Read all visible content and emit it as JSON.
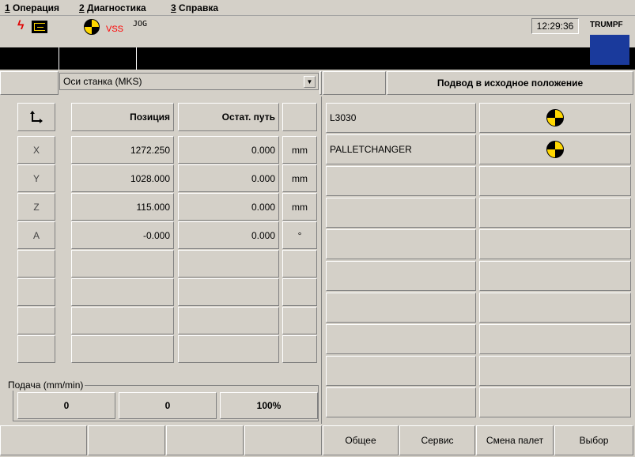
{
  "menu": [
    {
      "key": "1",
      "label": "Операция"
    },
    {
      "key": "2",
      "label": "Диагностика"
    },
    {
      "key": "3",
      "label": "Справка"
    }
  ],
  "status": {
    "vss_label": "VSS",
    "mode": "JOG",
    "time": "12:29:36",
    "brand": "TRUMPF",
    "colors": {
      "vss": "#ff0000",
      "brand_box": "#1a3a9c"
    }
  },
  "axes_panel": {
    "selector_value": "Оси станка (MKS)",
    "col_position": "Позиция",
    "col_remaining": "Остат. путь",
    "rows": [
      {
        "axis": "X",
        "position": "1272.250",
        "remaining": "0.000",
        "unit": "mm"
      },
      {
        "axis": "Y",
        "position": "1028.000",
        "remaining": "0.000",
        "unit": "mm"
      },
      {
        "axis": "Z",
        "position": "115.000",
        "remaining": "0.000",
        "unit": "mm"
      },
      {
        "axis": "A",
        "position": "-0.000",
        "remaining": "0.000",
        "unit": "°"
      }
    ],
    "feed_label": "Подача (mm/min)",
    "feed_values": [
      "0",
      "0",
      "100%"
    ]
  },
  "reference_panel": {
    "title": "Подвод в исходное положение",
    "items": [
      {
        "name": "L3030"
      },
      {
        "name": "PALLETCHANGER"
      }
    ]
  },
  "softkeys_right": [
    "Общее",
    "Сервис",
    "Смена палет",
    "Выбор"
  ]
}
